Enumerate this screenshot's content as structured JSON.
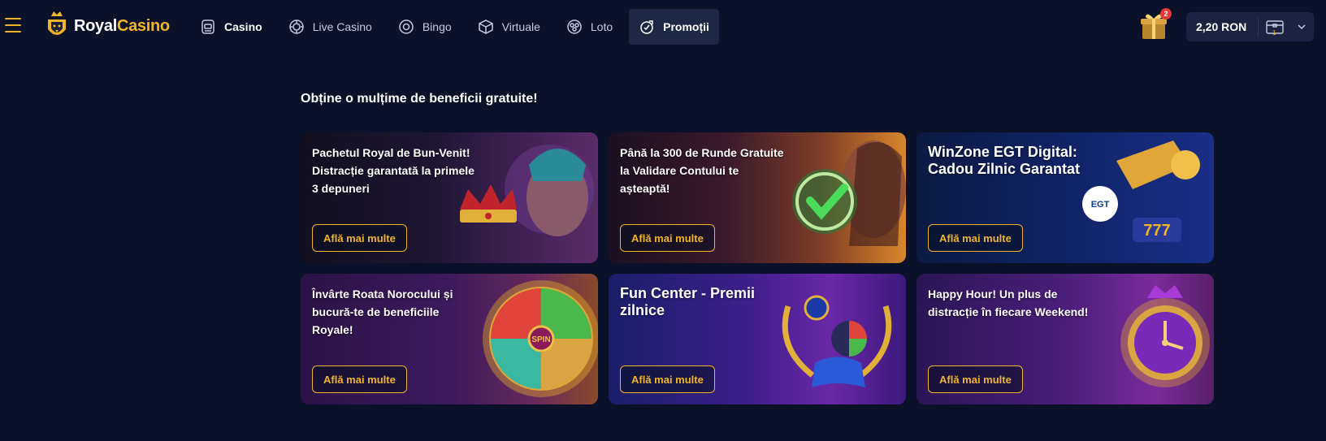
{
  "header": {
    "logo": {
      "part1": "Royal",
      "part2": "Casino"
    },
    "nav": [
      {
        "label": "Casino",
        "icon": "slot-machine-icon"
      },
      {
        "label": "Live Casino",
        "icon": "live-chip-icon"
      },
      {
        "label": "Bingo",
        "icon": "bingo-ball-icon"
      },
      {
        "label": "Virtuale",
        "icon": "virtual-cube-icon"
      },
      {
        "label": "Loto",
        "icon": "lottery-balls-icon"
      },
      {
        "label": "Promoții",
        "icon": "promo-badge-icon"
      }
    ],
    "gift_badge": "2",
    "balance": "2,20 RON",
    "chest_count": "1"
  },
  "headline": "Obține o mulțime de beneficii gratuite!",
  "cards": [
    {
      "title": "Pachetul Royal de Bun-Venit! Distracție garantată la primele 3 depuneri",
      "button": "Află mai multe"
    },
    {
      "title": "Până la 300 de Runde Gratuite la Validare Contului te așteaptă!",
      "button": "Află mai multe"
    },
    {
      "title": "WinZone EGT Digital: Cadou Zilnic Garantat",
      "button": "Află mai multe"
    },
    {
      "title": "Învârte Roata Norocului și bucură-te de beneficiile Royale!",
      "button": "Află mai multe"
    },
    {
      "title": "Fun Center - Premii zilnice",
      "button": "Află mai multe"
    },
    {
      "title": "Happy Hour! Un plus de distracție în fiecare Weekend!",
      "button": "Află mai multe"
    }
  ],
  "colors": {
    "accent": "#f0b429",
    "background": "#0b1128",
    "active_nav": "#1e2744"
  }
}
